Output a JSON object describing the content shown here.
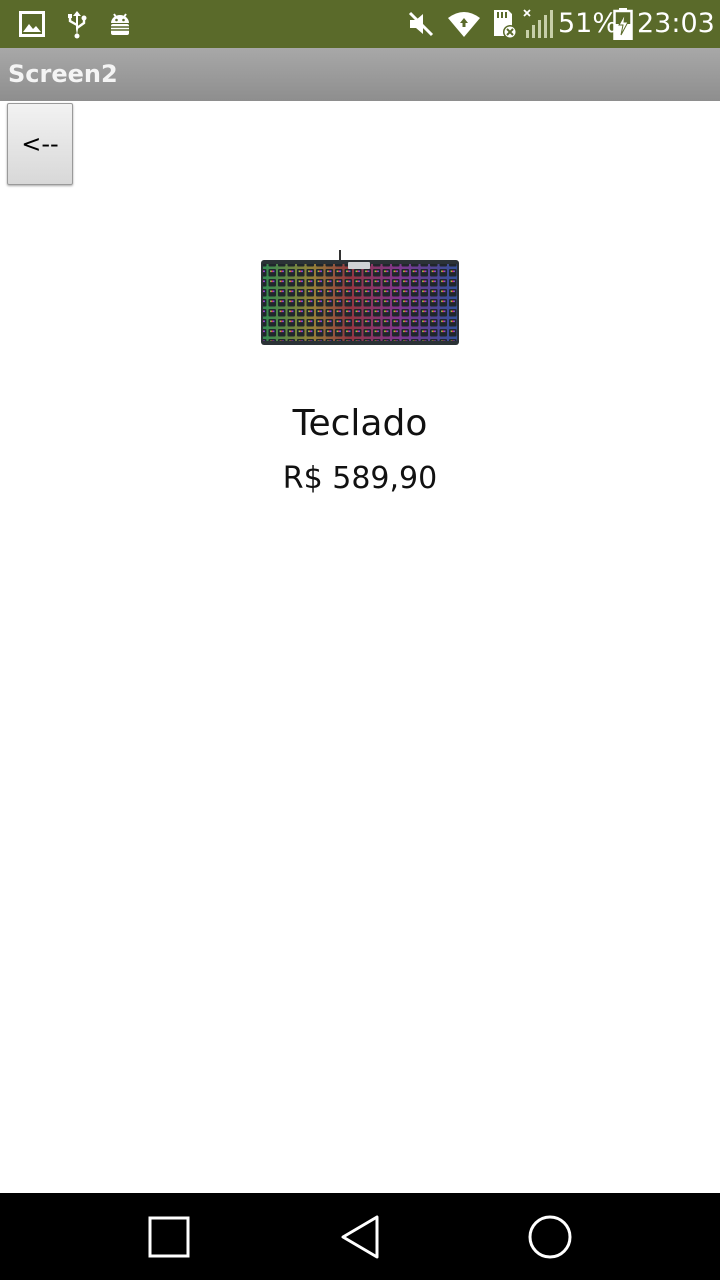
{
  "status_bar": {
    "battery_percent": "51%",
    "time": "23:03",
    "icons": [
      "gallery-icon",
      "usb-icon",
      "android-debug-icon",
      "mute-icon",
      "wifi-icon",
      "sd-card-icon",
      "signal-icon",
      "battery-charging-icon"
    ]
  },
  "app": {
    "title": "Screen2"
  },
  "toolbar": {
    "back_label": "<--"
  },
  "product": {
    "name": "Teclado",
    "price": "R$ 589,90",
    "image_icon": "keyboard-image"
  },
  "nav": {
    "icons": [
      "recents-icon",
      "back-icon",
      "home-icon"
    ]
  },
  "colors": {
    "status_bar": "#5a6a2a",
    "title_bar": "#9a9a9a",
    "nav_bar": "#000000"
  }
}
